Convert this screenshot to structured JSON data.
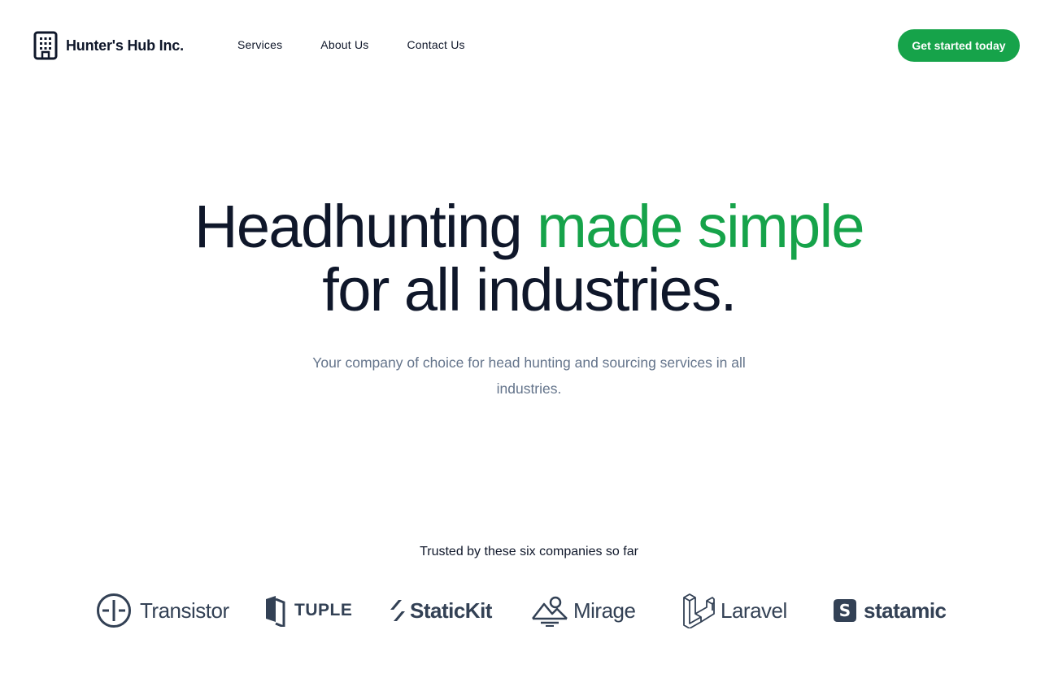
{
  "brand": {
    "name": "Hunter's Hub Inc.",
    "icon": "building-icon"
  },
  "nav": {
    "items": [
      {
        "label": "Services"
      },
      {
        "label": "About Us"
      },
      {
        "label": "Contact Us"
      }
    ]
  },
  "cta": {
    "label": "Get started today"
  },
  "hero": {
    "title_part1": "Headhunting ",
    "title_accent": "made simple",
    "title_part2": "for all industries.",
    "subtitle": "Your company of choice for head hunting and sourcing services in all industries."
  },
  "trusted": {
    "heading": "Trusted by these six companies so far",
    "logos": [
      {
        "name": "Transistor",
        "icon": "transistor-icon"
      },
      {
        "name": "TUPLE",
        "icon": "tuple-icon"
      },
      {
        "name": "StaticKit",
        "icon": "statickit-icon"
      },
      {
        "name": "Mirage",
        "icon": "mirage-icon"
      },
      {
        "name": "Laravel",
        "icon": "laravel-icon"
      },
      {
        "name": "statamic",
        "icon": "statamic-icon"
      }
    ]
  },
  "colors": {
    "accent": "#16a34a",
    "text": "#0f172a",
    "muted": "#64748b",
    "logo": "#334155"
  }
}
